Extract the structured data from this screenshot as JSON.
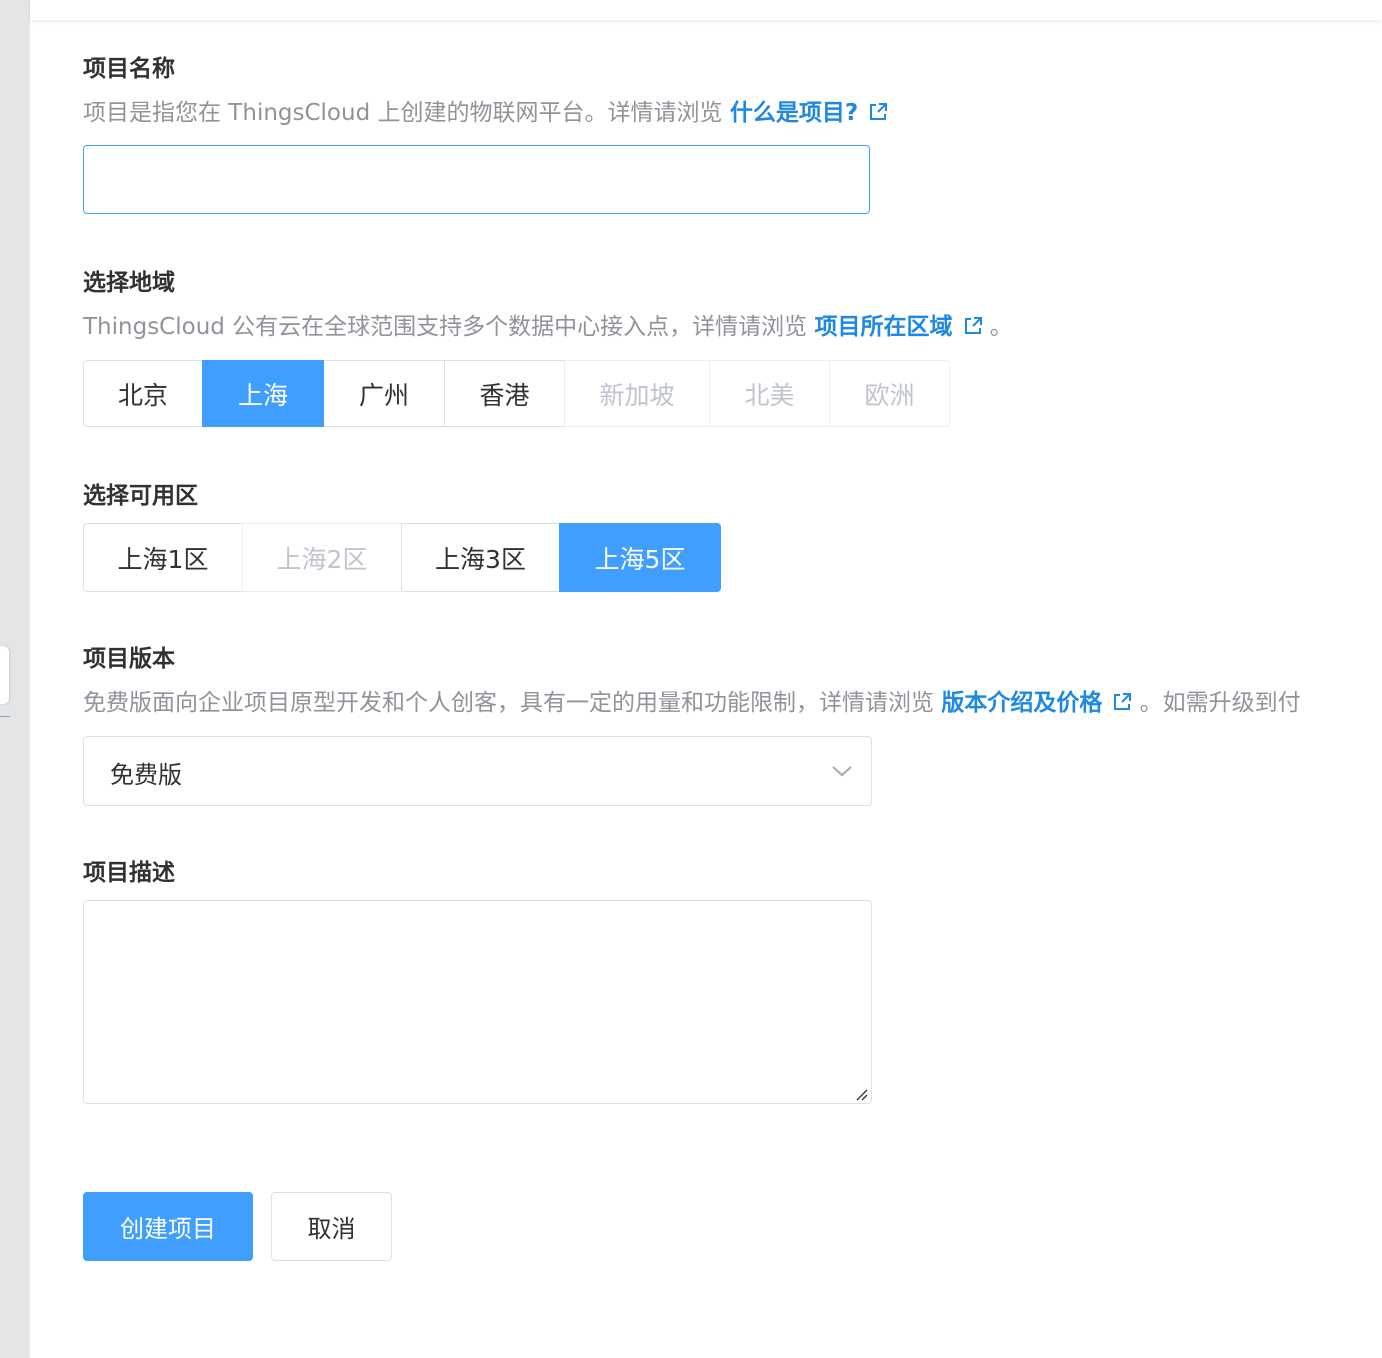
{
  "form": {
    "name": {
      "label": "项目名称",
      "desc": "项目是指您在 ThingsCloud 上创建的物联网平台。详情请浏览 ",
      "link": "什么是项目?",
      "value": ""
    },
    "region": {
      "label": "选择地域",
      "desc": "ThingsCloud 公有云在全球范围支持多个数据中心接入点，详情请浏览 ",
      "link": "项目所在区域",
      "suffix": " 。",
      "options": [
        "北京",
        "上海",
        "广州",
        "香港",
        "新加坡",
        "北美",
        "欧洲"
      ],
      "selected": "上海"
    },
    "zone": {
      "label": "选择可用区",
      "options": [
        "上海1区",
        "上海2区",
        "上海3区",
        "上海5区"
      ],
      "selected": "上海5区"
    },
    "edition": {
      "label": "项目版本",
      "desc": "免费版面向企业项目原型开发和个人创客，具有一定的用量和功能限制，详情请浏览 ",
      "link": "版本介绍及价格",
      "suffix": " 。如需升级到付",
      "value": "免费版"
    },
    "description": {
      "label": "项目描述",
      "value": ""
    }
  },
  "actions": {
    "create_label": "创建项目",
    "cancel_label": "取消"
  },
  "colors": {
    "primary": "#409eff",
    "link": "#1e88e5",
    "text": "#303133",
    "muted": "#909399",
    "disabled": "#c0c4cc"
  }
}
